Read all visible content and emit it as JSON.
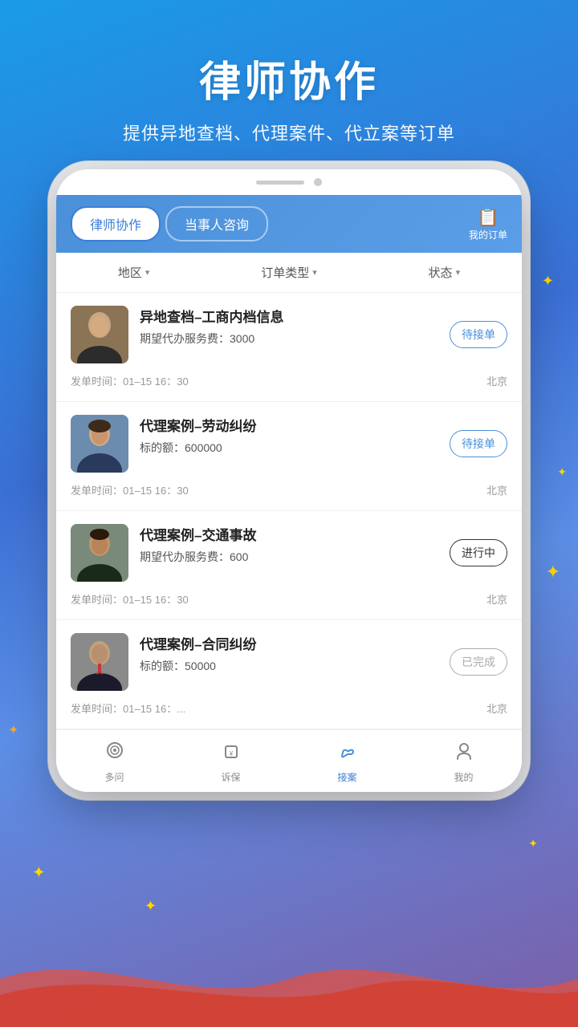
{
  "header": {
    "title": "律师协作",
    "subtitle": "提供异地查档、代理案件、代立案等订单"
  },
  "tabs": {
    "active": "律师协作",
    "inactive": "当事人咨询",
    "orders_label": "我的订单"
  },
  "filters": [
    {
      "label": "地区",
      "name": "region-filter"
    },
    {
      "label": "订单类型",
      "name": "order-type-filter"
    },
    {
      "label": "状态",
      "name": "status-filter"
    }
  ],
  "cases": [
    {
      "title": "异地查档–工商内档信息",
      "detail_label": "期望代办服务费：",
      "detail_value": "3000",
      "time": "发单时间：01–15 16：30",
      "location": "北京",
      "status": "待接单",
      "status_type": "pending",
      "avatar_gender": "female1"
    },
    {
      "title": "代理案例–劳动纠纷",
      "detail_label": "标的额：",
      "detail_value": "600000",
      "time": "发单时间：01–15 16：30",
      "location": "北京",
      "status": "待接单",
      "status_type": "pending",
      "avatar_gender": "female2"
    },
    {
      "title": "代理案例–交通事故",
      "detail_label": "期望代办服务费：",
      "detail_value": "600",
      "time": "发单时间：01–15 16：30",
      "location": "北京",
      "status": "进行中",
      "status_type": "ongoing",
      "avatar_gender": "male1"
    },
    {
      "title": "代理案例–合同纠纷",
      "detail_label": "标的额：",
      "detail_value": "50000",
      "time": "发单时间：01–15 16：...",
      "location": "北京",
      "status": "已完成",
      "status_type": "done",
      "avatar_gender": "male2"
    }
  ],
  "bottom_nav": [
    {
      "label": "多问",
      "icon": "💬",
      "name": "nav-ask",
      "active": false
    },
    {
      "label": "诉保",
      "icon": "💰",
      "name": "nav-sue",
      "active": false
    },
    {
      "label": "接案",
      "icon": "🤝",
      "name": "nav-accept",
      "active": true
    },
    {
      "label": "我的",
      "icon": "👤",
      "name": "nav-mine",
      "active": false
    }
  ],
  "colors": {
    "primary": "#4a90d9",
    "active_tab_bg": "#ffffff",
    "active_tab_text": "#3b7dd8"
  }
}
